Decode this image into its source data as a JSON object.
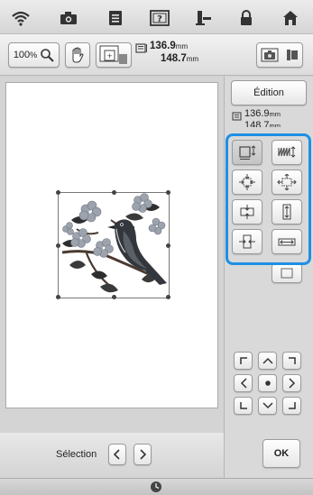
{
  "status_bar": {
    "icons": [
      "wifi-icon",
      "camera-icon",
      "document-icon",
      "help-icon",
      "thread-spool-icon",
      "lock-icon",
      "home-icon"
    ]
  },
  "toolbar": {
    "zoom_value": "100",
    "zoom_unit": "%",
    "width_value": "136.9",
    "height_value": "148.7",
    "unit": "mm"
  },
  "side_panel": {
    "edition_label": "Édition",
    "width_value": "136.9",
    "height_value": "148.7",
    "unit": "mm"
  },
  "selection": {
    "label": "Sélection"
  },
  "ok_label": "OK",
  "colors": {
    "highlight": "#1e90e6"
  }
}
